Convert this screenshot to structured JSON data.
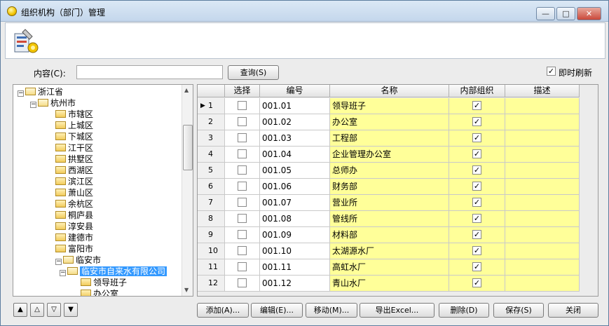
{
  "window": {
    "title": "组织机构（部门）管理",
    "minimize_label": "—",
    "maximize_label": "□",
    "close_label": "✕"
  },
  "search": {
    "label": "内容(C):",
    "value": "",
    "button_label": "查询(S)",
    "realtime_label": "即时刷新",
    "realtime_checked": true
  },
  "tree": {
    "nodes": [
      {
        "label": "浙江省",
        "expander": "−"
      },
      {
        "label": "杭州市",
        "expander": "−"
      },
      {
        "label": "市辖区"
      },
      {
        "label": "上城区"
      },
      {
        "label": "下城区"
      },
      {
        "label": "江干区"
      },
      {
        "label": "拱墅区"
      },
      {
        "label": "西湖区"
      },
      {
        "label": "滨江区"
      },
      {
        "label": "萧山区"
      },
      {
        "label": "余杭区"
      },
      {
        "label": "桐庐县"
      },
      {
        "label": "淳安县"
      },
      {
        "label": "建德市"
      },
      {
        "label": "富阳市"
      },
      {
        "label": "临安市",
        "expander": "−"
      },
      {
        "label": "临安市自来水有限公司",
        "expander": "−",
        "selected": true
      },
      {
        "label": "领导班子"
      },
      {
        "label": "办公室"
      }
    ]
  },
  "grid": {
    "columns": [
      "选择",
      "编号",
      "名称",
      "内部组织",
      "描述"
    ],
    "rows": [
      {
        "num": "1",
        "code": "001.01",
        "name": "领导班子",
        "internal": true,
        "desc": "",
        "current": true
      },
      {
        "num": "2",
        "code": "001.02",
        "name": "办公室",
        "internal": true,
        "desc": ""
      },
      {
        "num": "3",
        "code": "001.03",
        "name": "工程部",
        "internal": true,
        "desc": ""
      },
      {
        "num": "4",
        "code": "001.04",
        "name": "企业管理办公室",
        "internal": true,
        "desc": ""
      },
      {
        "num": "5",
        "code": "001.05",
        "name": "总师办",
        "internal": true,
        "desc": ""
      },
      {
        "num": "6",
        "code": "001.06",
        "name": "财务部",
        "internal": true,
        "desc": ""
      },
      {
        "num": "7",
        "code": "001.07",
        "name": "营业所",
        "internal": true,
        "desc": ""
      },
      {
        "num": "8",
        "code": "001.08",
        "name": "管线所",
        "internal": true,
        "desc": ""
      },
      {
        "num": "9",
        "code": "001.09",
        "name": "材料部",
        "internal": true,
        "desc": ""
      },
      {
        "num": "10",
        "code": "001.10",
        "name": "太湖源水厂",
        "internal": true,
        "desc": ""
      },
      {
        "num": "11",
        "code": "001.11",
        "name": "高虹水厂",
        "internal": true,
        "desc": ""
      },
      {
        "num": "12",
        "code": "001.12",
        "name": "青山水厂",
        "internal": true,
        "desc": ""
      }
    ]
  },
  "toolbar": {
    "move_top": "▲",
    "move_up": "△",
    "move_down": "▽",
    "move_bottom": "▼",
    "add": "添加(A)...",
    "edit": "编辑(E)...",
    "move": "移动(M)...",
    "export": "导出Excel...",
    "delete": "删除(D)",
    "save": "保存(S)",
    "close": "关闭"
  },
  "icons": {
    "title": "app-icon",
    "banner": "org-tools-icon",
    "checkmark": "✓",
    "current_row": "▶"
  }
}
